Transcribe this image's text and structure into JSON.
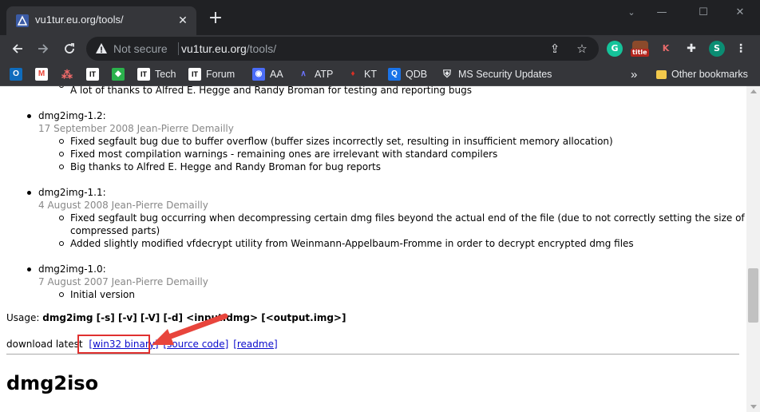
{
  "browser": {
    "tab_title": "vu1tur.eu.org/tools/",
    "tab_close": "✕",
    "newtab": "+",
    "window_minimize": "—",
    "window_maximize": "☐",
    "window_close": "✕",
    "security_label": "Not secure",
    "url_domain": "vu1tur.eu.org",
    "url_path": "/tools/",
    "profile_initial": "S",
    "extension_title_badge": "title",
    "extension_k": "K",
    "extension_g": "G"
  },
  "bookmarks": [
    {
      "label": "",
      "icon": "outlook-icon",
      "color": "#0f6cbd",
      "glyph": "O"
    },
    {
      "label": "",
      "icon": "gmail-icon",
      "color": "#ea4335",
      "glyph": "M"
    },
    {
      "label": "",
      "icon": "asana-icon",
      "color": "#f06a6a",
      "glyph": "●"
    },
    {
      "label": "",
      "icon": "it-icon",
      "color": "#ffffff",
      "glyph": "IT"
    },
    {
      "label": "",
      "icon": "feedly-icon",
      "color": "#2bb24c",
      "glyph": "◆"
    },
    {
      "label": "Tech",
      "icon": "it-icon",
      "color": "#ffffff",
      "glyph": "IT"
    },
    {
      "label": "Forum",
      "icon": "it-icon",
      "color": "#ffffff",
      "glyph": "IT"
    },
    {
      "label": "AA",
      "icon": "eye-icon",
      "color": "#4a6cf7",
      "glyph": "◉"
    },
    {
      "label": "ATP",
      "icon": "atp-icon",
      "color": "#3b3fbf",
      "glyph": "∧"
    },
    {
      "label": "KT",
      "icon": "flame-icon",
      "color": "#d93025",
      "glyph": "♦"
    },
    {
      "label": "QDB",
      "icon": "q-icon",
      "color": "#1a73e8",
      "glyph": "Q"
    },
    {
      "label": "MS Security Updates",
      "icon": "shield-icon",
      "color": "#35363a",
      "glyph": "⛨"
    }
  ],
  "bookmarks_overflow": "»",
  "other_bookmarks": "Other bookmarks",
  "page": {
    "partial_line": "A lot of thanks to Alfred E. Hegge and Randy Broman for testing and reporting bugs",
    "entries": [
      {
        "version": "dmg2img-1.2:",
        "date": "17 September 2008 Jean-Pierre Demailly",
        "items": [
          "Fixed segfault bug due to buffer overflow (buffer sizes incorrectly set, resulting in insufficient memory allocation)",
          "Fixed most compilation warnings - remaining ones are irrelevant with standard compilers",
          "Big thanks to Alfred E. Hegge and Randy Broman for bug reports"
        ]
      },
      {
        "version": "dmg2img-1.1:",
        "date": "4 August 2008 Jean-Pierre Demailly",
        "items": [
          "Fixed segfault bug occurring when decompressing certain dmg files beyond the actual end of the file (due to not correctly setting the size of the",
          "compressed parts)",
          "Added slightly modified vfdecrypt utility from Weinmann-Appelbaum-Fromme in order to decrypt encrypted dmg files"
        ]
      },
      {
        "version": "dmg2img-1.0:",
        "date": "7 August 2007 Jean-Pierre Demailly",
        "items": [
          "Initial version"
        ]
      }
    ],
    "usage_label": "Usage:",
    "usage_cmd": "dmg2img [-s] [-v] [-V] [-d] <input.dmg> [<output.img>]",
    "download_label": "download latest",
    "link_win32": "[win32 binary]",
    "link_source": "[source code]",
    "link_readme": "[readme]",
    "heading": "dmg2iso"
  },
  "annotation": {
    "highlight_color": "#e0302f",
    "arrow_color": "#e8453c"
  }
}
